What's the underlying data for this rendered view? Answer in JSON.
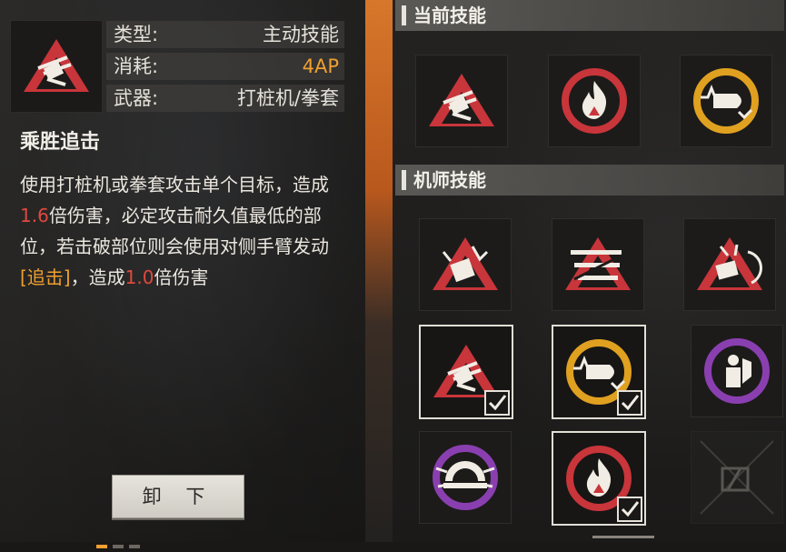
{
  "detail": {
    "attributes": [
      {
        "key": "类型:",
        "value": "主动技能"
      },
      {
        "key": "消耗:",
        "value": "4AP"
      },
      {
        "key": "武器:",
        "value": "打桩机/拳套"
      }
    ],
    "skill_name": "乘胜追击",
    "description": {
      "part1": "使用打桩机或拳套攻击单个目标，造成",
      "damage1": "1.6",
      "part2": "倍伤害，必定攻击耐久值最低的部位，若击破部位则会使用对侧手臂发动",
      "followup": "[追击]",
      "part3": "，造成",
      "damage2": "1.0",
      "part4": "倍伤害"
    },
    "unequip_label": "卸 下"
  },
  "sections": {
    "current": "当前技能",
    "mechanic": "机师技能"
  },
  "current_skills": [
    {
      "icon": "pile-driver-triangle-icon",
      "color": "#c8353a"
    },
    {
      "icon": "fire-circle-icon",
      "color": "#c8353a"
    },
    {
      "icon": "bullet-circle-icon",
      "color": "#e0a020"
    }
  ],
  "mechanic_skills": [
    {
      "icon": "shattered-fist-triangle-icon",
      "color": "#c8353a",
      "selected": false,
      "checked": false
    },
    {
      "icon": "slash-stripes-triangle-icon",
      "color": "#c8353a",
      "selected": false,
      "checked": false
    },
    {
      "icon": "spinning-fist-triangle-icon",
      "color": "#c8353a",
      "selected": false,
      "checked": false
    },
    {
      "icon": "pile-driver-triangle-icon",
      "color": "#c8353a",
      "selected": true,
      "checked": true
    },
    {
      "icon": "bullet-circle-icon",
      "color": "#e0a020",
      "selected": true,
      "checked": true
    },
    {
      "icon": "shield-figure-circle-icon",
      "color": "#8a3fb0",
      "selected": false,
      "checked": false
    },
    {
      "icon": "eye-spikes-circle-icon",
      "color": "#8a3fb0",
      "selected": false,
      "checked": false
    },
    {
      "icon": "fire-circle-icon",
      "color": "#c8353a",
      "selected": true,
      "checked": true
    },
    {
      "icon": "locked-slot-icon",
      "color": "#666666",
      "selected": false,
      "checked": false
    }
  ],
  "pager": {
    "pages": 3,
    "active": 1
  }
}
